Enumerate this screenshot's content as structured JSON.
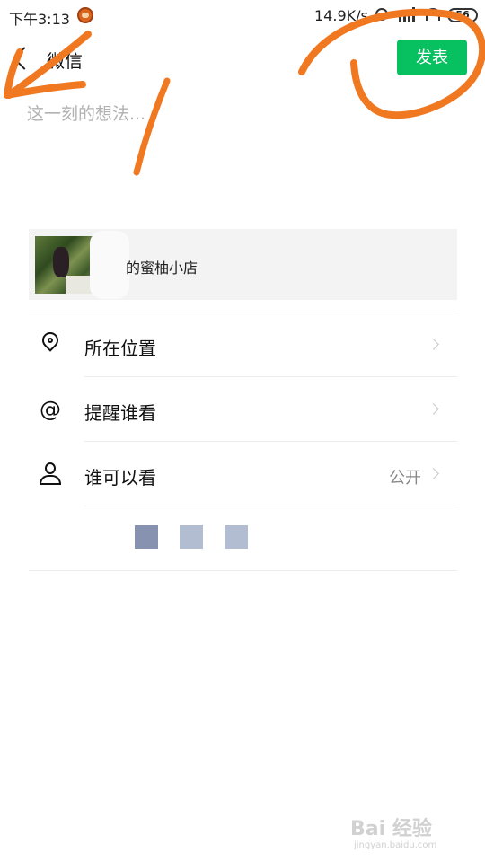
{
  "status_bar": {
    "time": "下午3:13",
    "net_speed": "14.9K/s",
    "battery": "56"
  },
  "header": {
    "back_icon": "chevron-left-icon",
    "title": "微信",
    "publish_label": "发表"
  },
  "composer": {
    "placeholder": "这一刻的想法..."
  },
  "link_card": {
    "title": "的蜜柚小店"
  },
  "rows": [
    {
      "icon": "location-icon",
      "label": "所在位置",
      "value": ""
    },
    {
      "icon": "at-icon",
      "label": "提醒谁看",
      "value": ""
    },
    {
      "icon": "user-icon",
      "label": "谁可以看",
      "value": "公开"
    }
  ],
  "placeholder_blocks": [
    {
      "color": "#8692b0"
    },
    {
      "color": "#b3bdd2"
    },
    {
      "color": "#b3bdd2"
    }
  ],
  "colors": {
    "accent": "#07c160",
    "annotation": "#f07820"
  },
  "watermark": {
    "main": "Bai 经验",
    "sub": "jingyan.baidu.com"
  }
}
